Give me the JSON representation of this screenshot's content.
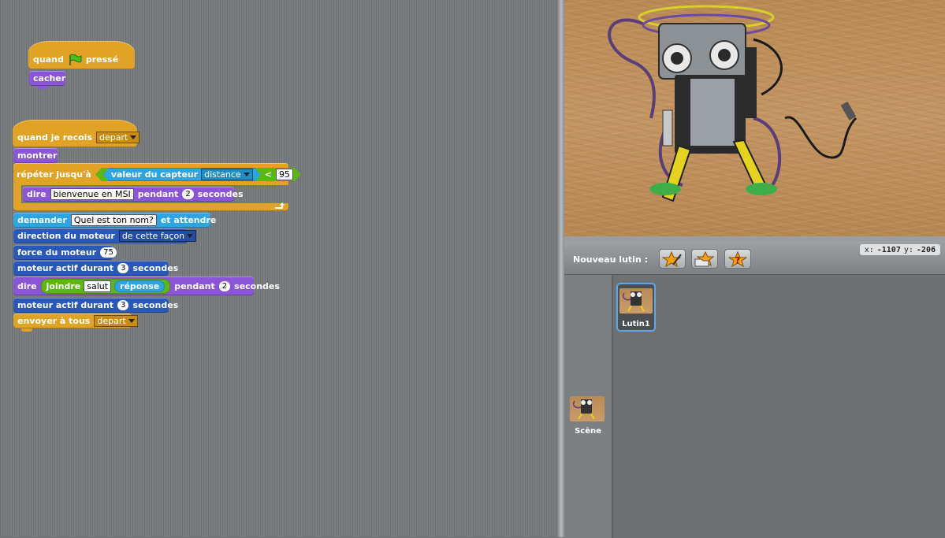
{
  "script1": {
    "hat_before": "quand",
    "hat_after": "pressé",
    "hide": "cacher"
  },
  "script2": {
    "hat_label": "quand je recois",
    "hat_message": "depart",
    "show": "montrer",
    "repeat_label": "répéter jusqu'à",
    "sensor_label": "valeur du capteur",
    "sensor_name": "distance",
    "lt": "<",
    "lt_value": "95",
    "say_label": "dire",
    "say_text": "bienvenue en MSI",
    "say_for": "pendant",
    "say_secs": "2",
    "say_unit": "secondes",
    "ask_label": "demander",
    "ask_text": "Quel est ton nom?",
    "ask_wait": "et attendre",
    "motor_dir_label": "direction du moteur",
    "motor_dir_value": "de cette façon",
    "motor_power_label": "force du moteur",
    "motor_power_value": "75",
    "motor_on_label": "moteur actif durant",
    "motor_on_secs": "3",
    "motor_on_unit": "secondes",
    "say2_label": "dire",
    "join_label": "joindre",
    "join_text": "salut",
    "answer_label": "réponse",
    "say2_for": "pendant",
    "say2_secs": "2",
    "say2_unit": "secondes",
    "motor_on2_label": "moteur actif durant",
    "motor_on2_secs": "3",
    "motor_on2_unit": "secondes",
    "broadcast_label": "envoyer à tous",
    "broadcast_message": "depart"
  },
  "sprite_bar": {
    "new_sprite": "Nouveau lutin :",
    "x_label": "x:",
    "x_value": "-1107",
    "y_label": "y:",
    "y_value": "-206"
  },
  "sprites": {
    "stage_label": "Scène",
    "sprite1_label": "Lutin1"
  },
  "icons": {
    "green_flag": "green-flag-icon",
    "paint": "paint-new-sprite-icon",
    "folder": "choose-sprite-from-file-icon",
    "surprise": "random-sprite-icon"
  },
  "colors": {
    "control": "#e1a325",
    "looks": "#8a55d7",
    "sensing": "#2ca5e2",
    "motor": "#2a58b8",
    "operators": "#5cb712"
  }
}
